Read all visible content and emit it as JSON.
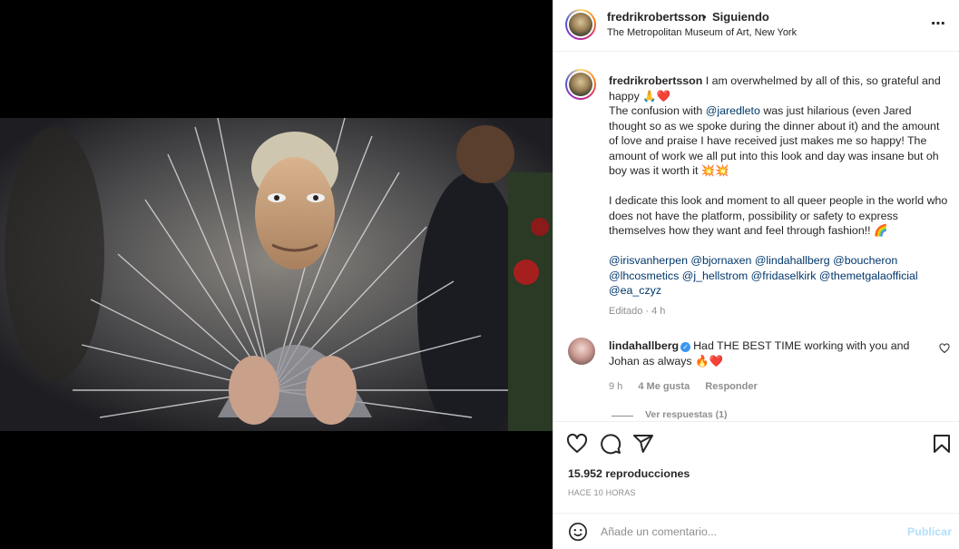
{
  "header": {
    "username": "fredrikrobertsson",
    "separator": "•",
    "follow_status": "Siguiendo",
    "location": "The Metropolitan Museum of Art, New York",
    "more_icon": "ellipsis-icon",
    "more_label": "..."
  },
  "caption": {
    "username": "fredrikrobertsson",
    "line1": "I am overwhelmed by all of this, so grateful and happy 🙏❤️",
    "p2_a": "The confusion with ",
    "p2_mention": "@jaredleto",
    "p2_b": " was just hilarious (even Jared thought so as we spoke during the dinner about it) and the amount of love and praise I have received just makes me so happy! The amount of work we all put into this look and day was insane but oh boy was it worth it 💥💥",
    "p3": "I dedicate this look and moment to all queer people in the world who does not have the platform, possibility or safety to express themselves how they want and feel through fashion!! 🌈",
    "mentions": "@irisvanherpen @bjornaxen @lindahallberg @boucheron @lhcosmetics @j_hellstrom @fridaselkirk @themetgalaofficial @ea_czyz",
    "meta": "Editado · 4 h"
  },
  "comment": {
    "username": "lindahallberg",
    "verified_mark": "✓",
    "text": "Had THE BEST TIME working with you and Johan as always 🔥❤️",
    "time": "9 h",
    "likes": "4 Me gusta",
    "reply": "Responder",
    "view_replies": "Ver respuestas (1)"
  },
  "actions": {
    "like_icon": "heart-icon",
    "comment_icon": "comment-icon",
    "share_icon": "share-icon",
    "save_icon": "bookmark-icon"
  },
  "stats": {
    "views": "15.952 reproducciones",
    "time_ago": "HACE 10 HORAS"
  },
  "add_comment": {
    "placeholder": "Añade un comentario...",
    "publish": "Publicar"
  },
  "colors": {
    "link": "#00376b",
    "muted": "#8e8e8e",
    "publish_disabled": "#b2dffc",
    "like_red": "#ed4956"
  }
}
